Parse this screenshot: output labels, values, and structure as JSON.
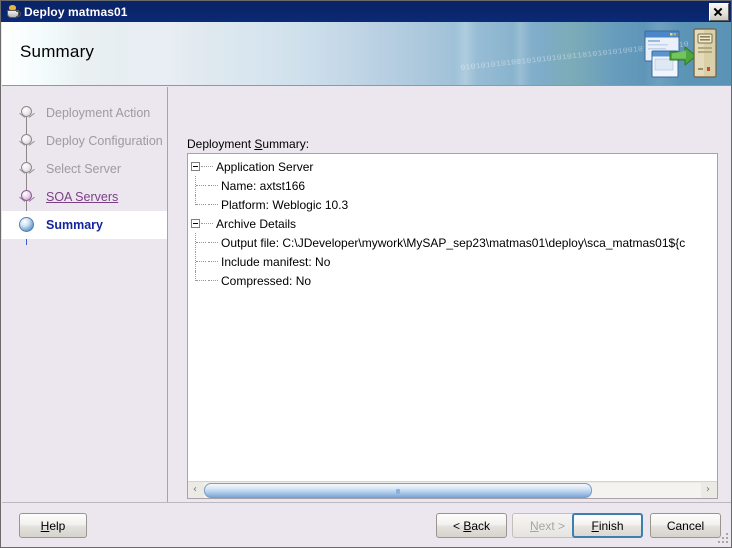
{
  "window": {
    "title": "Deploy matmas01",
    "title_icon": "java-cup-icon",
    "close_label": "×"
  },
  "header": {
    "title": "Summary",
    "icon": "deploy-to-server-icon",
    "watermark": "01010101010010101010101101010101001010100101010101"
  },
  "sidebar": {
    "steps": [
      {
        "label": "Deployment Action",
        "state": "pending"
      },
      {
        "label": "Deploy Configuration",
        "state": "pending"
      },
      {
        "label": "Select Server",
        "state": "pending"
      },
      {
        "label": "SOA Servers",
        "state": "visited"
      },
      {
        "label": "Summary",
        "state": "current"
      }
    ]
  },
  "content": {
    "label": "Deployment Summary:",
    "label_mnemonic": "S",
    "tree": [
      {
        "label": "Application Server",
        "expanded": true,
        "children": [
          {
            "label": "Name: axtst166"
          },
          {
            "label": "Platform: Weblogic 10.3"
          }
        ]
      },
      {
        "label": "Archive Details",
        "expanded": true,
        "children": [
          {
            "label": "Output file: C:\\JDeveloper\\mywork\\MySAP_sep23\\matmas01\\deploy\\sca_matmas01${c"
          },
          {
            "label": "Include manifest: No"
          },
          {
            "label": "Compressed: No"
          }
        ]
      }
    ],
    "scrollbar": {
      "left_arrow": "‹",
      "right_arrow": "›",
      "thumb_percent": 78
    }
  },
  "footer": {
    "buttons": [
      {
        "name": "help",
        "label": "Help",
        "mnemonic": "H",
        "state": "enabled"
      },
      {
        "name": "back",
        "label": "< Back",
        "mnemonic": "B",
        "state": "enabled"
      },
      {
        "name": "next",
        "label": "Next >",
        "mnemonic": "N",
        "state": "disabled"
      },
      {
        "name": "finish",
        "label": "Finish",
        "mnemonic": "F",
        "state": "default"
      },
      {
        "name": "cancel",
        "label": "Cancel",
        "mnemonic": "",
        "state": "enabled"
      }
    ]
  },
  "colors": {
    "titlebar": "#0a246a",
    "sidebar_bg": "#ece7ee",
    "panel_bg": "#ffffff",
    "active_step_text": "#14259b",
    "visited_step_text": "#7b3f86",
    "pending_step_text": "#9d9aa1",
    "default_button_border": "#3c7fb1"
  }
}
